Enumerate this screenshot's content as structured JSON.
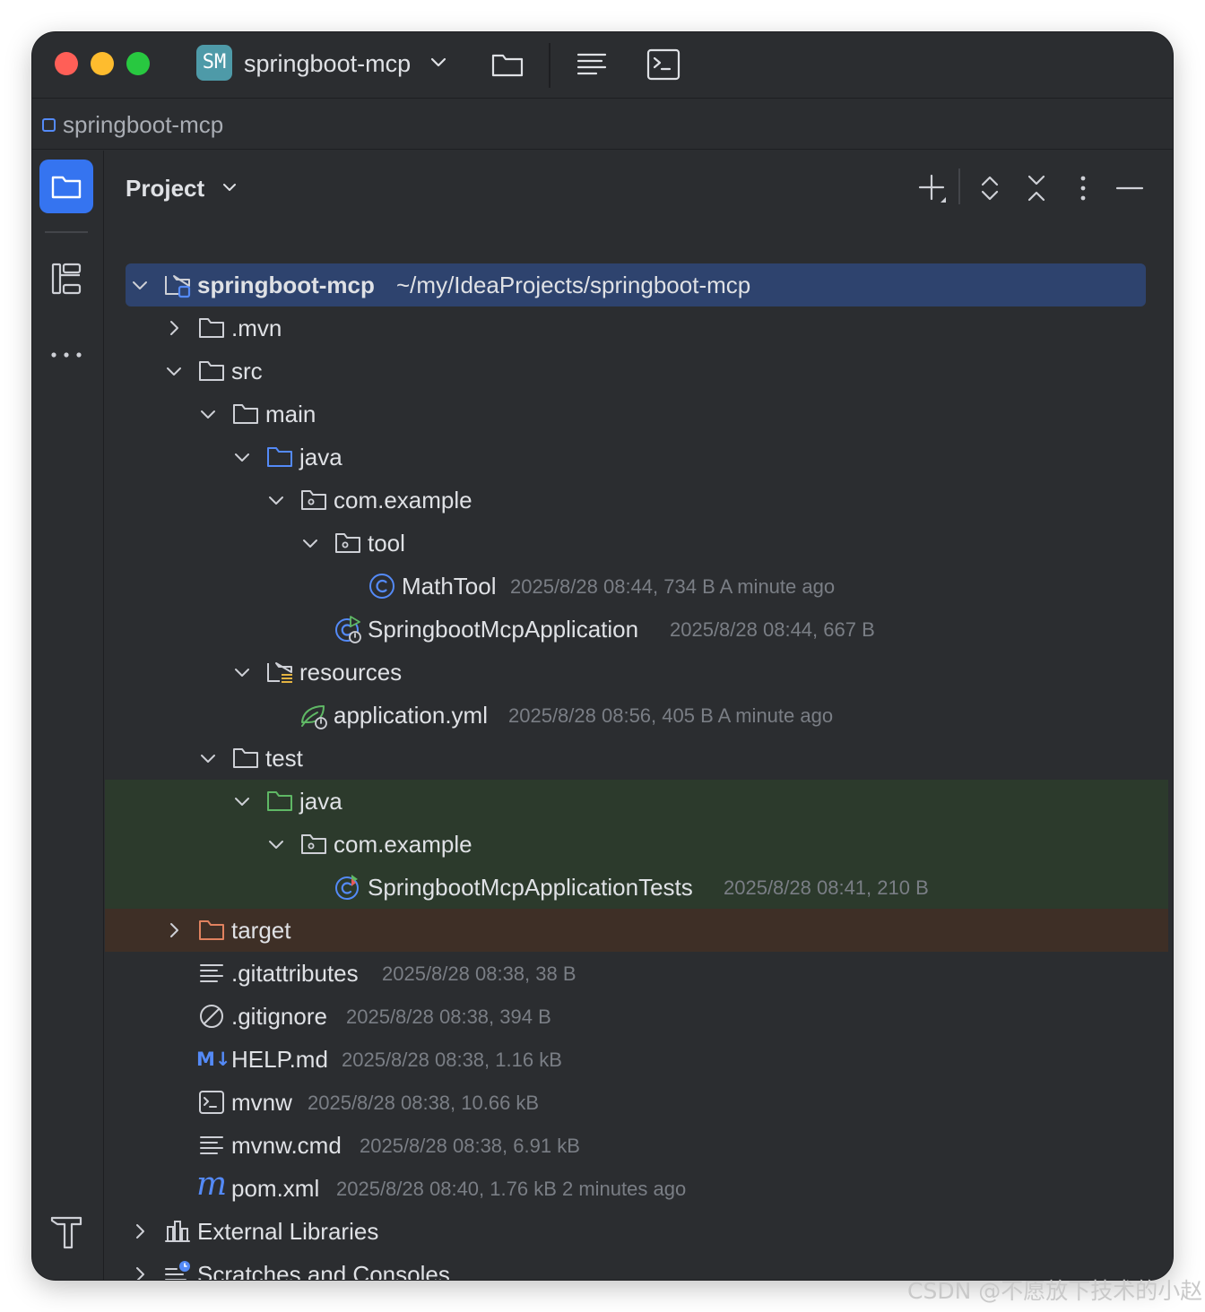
{
  "window": {
    "project_badge": "SM",
    "project_name": "springboot-mcp"
  },
  "breadcrumb": {
    "label": "springboot-mcp"
  },
  "panel": {
    "title": "Project"
  },
  "tree": {
    "root": {
      "name": "springboot-mcp",
      "path": "~/my/IdeaProjects/springboot-mcp"
    },
    "mvn": {
      "name": ".mvn"
    },
    "src": {
      "name": "src"
    },
    "main": {
      "name": "main"
    },
    "main_java": {
      "name": "java"
    },
    "main_pkg": {
      "name": "com.example"
    },
    "tool": {
      "name": "tool"
    },
    "mathtool": {
      "name": "MathTool",
      "meta": "2025/8/28 08:44, 734 B A minute ago"
    },
    "app": {
      "name": "SpringbootMcpApplication",
      "meta": "2025/8/28 08:44, 667 B"
    },
    "resources": {
      "name": "resources"
    },
    "yml": {
      "name": "application.yml",
      "meta": "2025/8/28 08:56, 405 B A minute ago"
    },
    "test": {
      "name": "test"
    },
    "test_java": {
      "name": "java"
    },
    "test_pkg": {
      "name": "com.example"
    },
    "tests": {
      "name": "SpringbootMcpApplicationTests",
      "meta": "2025/8/28 08:41, 210 B"
    },
    "target": {
      "name": "target"
    },
    "gitattributes": {
      "name": ".gitattributes",
      "meta": "2025/8/28 08:38, 38 B"
    },
    "gitignore": {
      "name": ".gitignore",
      "meta": "2025/8/28 08:38, 394 B"
    },
    "help": {
      "name": "HELP.md",
      "meta": "2025/8/28 08:38, 1.16 kB",
      "icon_text": "M↓"
    },
    "mvnw": {
      "name": "mvnw",
      "meta": "2025/8/28 08:38, 10.66 kB"
    },
    "mvnwcmd": {
      "name": "mvnw.cmd",
      "meta": "2025/8/28 08:38, 6.91 kB"
    },
    "pom": {
      "name": "pom.xml",
      "meta": "2025/8/28 08:40, 1.76 kB 2 minutes ago",
      "icon_text": "m"
    },
    "ext_libs": {
      "name": "External Libraries"
    },
    "scratches": {
      "name": "Scratches and Consoles"
    }
  },
  "watermark": "CSDN @不愿放下技术的小赵",
  "colors": {
    "background": "#2b2d30",
    "selection": "#2e436e",
    "test_root_bg": "#2c3a2c",
    "excluded_bg": "#3e2f26",
    "accent_blue": "#3574f0",
    "text": "#dfe1e5",
    "meta_text": "#7a7e85"
  },
  "icons": {
    "titlebar": [
      "project-badge",
      "chevron-down-icon",
      "folder-icon",
      "structure-icon",
      "terminal-icon"
    ],
    "strip": [
      "project-folder-icon",
      "structure-icon",
      "more-icon",
      "build-hammer-icon"
    ],
    "panel_toolbar": [
      "add-icon",
      "expand-collapse-icon",
      "collapse-all-icon",
      "options-icon",
      "hide-icon"
    ]
  }
}
